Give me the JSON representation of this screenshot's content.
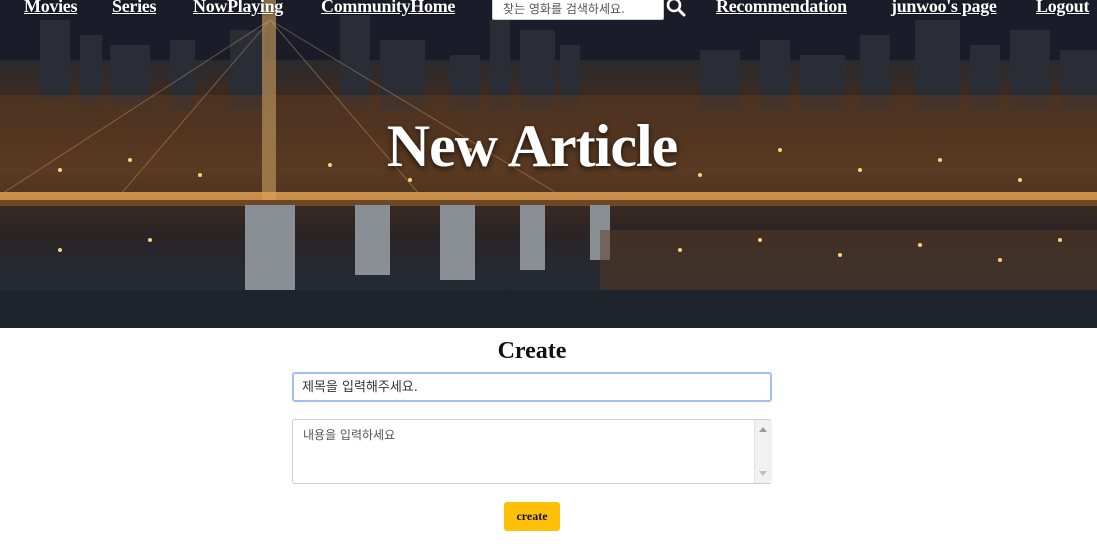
{
  "nav": {
    "items": [
      {
        "label": "Movies"
      },
      {
        "label": "Series"
      },
      {
        "label": "NowPlaying"
      },
      {
        "label": "CommunityHome"
      },
      {
        "label": "Recommendation"
      },
      {
        "label": "junwoo's page"
      },
      {
        "label": "Logout"
      }
    ],
    "search_placeholder": "찾는 영화를 검색하세요.",
    "search_icon": "search-icon"
  },
  "hero": {
    "title": "New Article"
  },
  "form": {
    "heading": "Create",
    "title_placeholder": "제목을 입력해주세요.",
    "title_value": "",
    "content_placeholder": "내용을 입력하세요",
    "content_value": "",
    "submit_label": "create",
    "submit_color": "#ffc107"
  }
}
